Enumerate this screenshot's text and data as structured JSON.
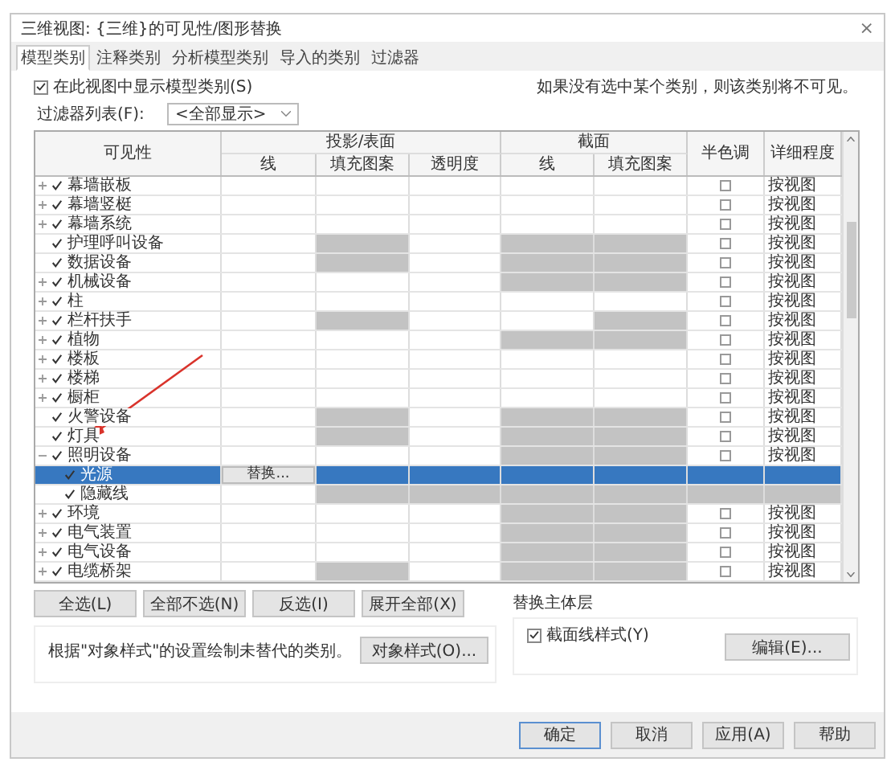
{
  "window": {
    "title": "三维视图: {三维}的可见性/图形替换",
    "close": "×"
  },
  "tabs": [
    {
      "label": "模型类别",
      "selected": true
    },
    {
      "label": "注释类别",
      "selected": false
    },
    {
      "label": "分析模型类别",
      "selected": false
    },
    {
      "label": "导入的类别",
      "selected": false
    },
    {
      "label": "过滤器",
      "selected": false
    }
  ],
  "show_categories": {
    "label": "在此视图中显示模型类别(S)",
    "checked": true
  },
  "note": "如果没有选中某个类别，则该类别将不可见。",
  "filter": {
    "label": "过滤器列表(F):",
    "value": "<全部显示>"
  },
  "table": {
    "visibility_header": "可见性",
    "groups": [
      {
        "label": "投影/表面",
        "columns": [
          "线",
          "填充图案",
          "透明度"
        ]
      },
      {
        "label": "截面",
        "columns": [
          "线",
          "填充图案"
        ]
      }
    ],
    "halftone_header": "半色调",
    "detail_header": "详细程度",
    "rows": [
      {
        "name": "幕墙嵌板",
        "expanded": false,
        "visible": true,
        "selected": false,
        "greyed": [
          false,
          false,
          false,
          false,
          false,
          false,
          false
        ],
        "halftone": false,
        "detail": "按视图"
      },
      {
        "name": "幕墙竖梃",
        "expanded": false,
        "visible": true,
        "selected": false,
        "greyed": [
          false,
          false,
          false,
          false,
          false,
          false,
          false
        ],
        "halftone": false,
        "detail": "按视图"
      },
      {
        "name": "幕墙系统",
        "expanded": false,
        "visible": true,
        "selected": false,
        "greyed": [
          false,
          false,
          false,
          false,
          false,
          false,
          false
        ],
        "halftone": false,
        "detail": "按视图"
      },
      {
        "name": "护理呼叫设备",
        "visible": true,
        "selected": false,
        "greyed": [
          false,
          true,
          false,
          true,
          true,
          false,
          false
        ],
        "halftone": false,
        "detail": "按视图"
      },
      {
        "name": "数据设备",
        "visible": true,
        "selected": false,
        "greyed": [
          false,
          true,
          false,
          true,
          true,
          false,
          false
        ],
        "halftone": false,
        "detail": "按视图"
      },
      {
        "name": "机械设备",
        "expanded": false,
        "visible": true,
        "selected": false,
        "greyed": [
          false,
          false,
          false,
          true,
          true,
          false,
          false
        ],
        "halftone": false,
        "detail": "按视图"
      },
      {
        "name": "柱",
        "expanded": false,
        "visible": true,
        "selected": false,
        "greyed": [
          false,
          false,
          false,
          false,
          false,
          false,
          false
        ],
        "halftone": false,
        "detail": "按视图"
      },
      {
        "name": "栏杆扶手",
        "expanded": false,
        "visible": true,
        "selected": false,
        "greyed": [
          false,
          true,
          false,
          false,
          true,
          false,
          false
        ],
        "halftone": false,
        "detail": "按视图"
      },
      {
        "name": "植物",
        "expanded": false,
        "visible": true,
        "selected": false,
        "greyed": [
          false,
          false,
          false,
          true,
          true,
          false,
          false
        ],
        "halftone": false,
        "detail": "按视图"
      },
      {
        "name": "楼板",
        "expanded": false,
        "visible": true,
        "selected": false,
        "greyed": [
          false,
          false,
          false,
          false,
          false,
          false,
          false
        ],
        "halftone": false,
        "detail": "按视图"
      },
      {
        "name": "楼梯",
        "expanded": false,
        "visible": true,
        "selected": false,
        "greyed": [
          false,
          false,
          false,
          false,
          false,
          false,
          false
        ],
        "halftone": false,
        "detail": "按视图"
      },
      {
        "name": "橱柜",
        "expanded": false,
        "visible": true,
        "selected": false,
        "greyed": [
          false,
          false,
          false,
          false,
          false,
          false,
          false
        ],
        "halftone": false,
        "detail": "按视图"
      },
      {
        "name": "火警设备",
        "visible": true,
        "selected": false,
        "greyed": [
          false,
          true,
          false,
          true,
          true,
          false,
          false
        ],
        "halftone": false,
        "detail": "按视图"
      },
      {
        "name": "灯具",
        "visible": true,
        "selected": false,
        "greyed": [
          false,
          true,
          false,
          true,
          true,
          false,
          false
        ],
        "halftone": false,
        "detail": "按视图"
      },
      {
        "name": "照明设备",
        "expanded": true,
        "visible": true,
        "selected": false,
        "greyed": [
          false,
          false,
          false,
          true,
          true,
          false,
          false
        ],
        "halftone": false,
        "detail": "按视图",
        "children": [
          {
            "name": "光源",
            "visible": true,
            "selected": true,
            "greyed": [
              false,
              false,
              false,
              false,
              false,
              false,
              false
            ],
            "override_button": "替换..."
          },
          {
            "name": "隐藏线",
            "visible": true,
            "selected": false,
            "greyed": [
              false,
              true,
              true,
              true,
              true,
              true,
              true
            ]
          }
        ]
      },
      {
        "name": "环境",
        "expanded": false,
        "visible": true,
        "selected": false,
        "greyed": [
          false,
          false,
          false,
          true,
          true,
          false,
          false
        ],
        "halftone": false,
        "detail": "按视图"
      },
      {
        "name": "电气装置",
        "expanded": false,
        "visible": true,
        "selected": false,
        "greyed": [
          false,
          false,
          false,
          true,
          true,
          false,
          false
        ],
        "halftone": false,
        "detail": "按视图"
      },
      {
        "name": "电气设备",
        "expanded": false,
        "visible": true,
        "selected": false,
        "greyed": [
          false,
          false,
          false,
          true,
          true,
          false,
          false
        ],
        "halftone": false,
        "detail": "按视图"
      },
      {
        "name": "电缆桥架",
        "expanded": false,
        "visible": true,
        "selected": false,
        "greyed": [
          false,
          true,
          false,
          true,
          true,
          false,
          false
        ],
        "halftone": false,
        "detail": "按视图"
      }
    ]
  },
  "tree_buttons": [
    "全选(L)",
    "全部不选(N)",
    "反选(I)",
    "展开全部(X)"
  ],
  "object_styles": {
    "text": "根据\"对象样式\"的设置绘制未替代的类别。",
    "button": "对象样式(O)..."
  },
  "host_layers": {
    "title": "替换主体层",
    "checkbox": {
      "label": "截面线样式(Y)",
      "checked": true
    },
    "button": "编辑(E)..."
  },
  "footer_buttons": [
    {
      "label": "确定",
      "selected": true
    },
    {
      "label": "取消",
      "selected": false
    },
    {
      "label": "应用(A)",
      "selected": false
    },
    {
      "label": "帮助",
      "selected": false
    }
  ]
}
